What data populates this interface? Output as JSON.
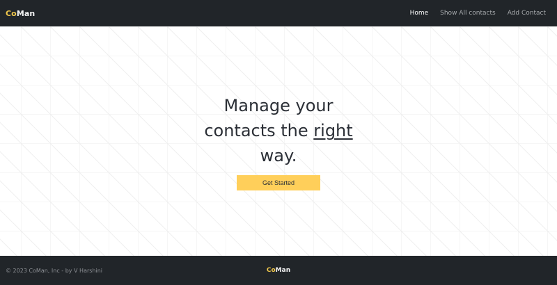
{
  "nav": {
    "brand_accent": "Co",
    "brand_rest": "Man",
    "links": [
      "Home",
      "Show All contacts",
      "Add Contact"
    ]
  },
  "hero": {
    "headline_before": "Manage your contacts the ",
    "headline_emphasis": "right",
    "headline_after": " way.",
    "cta_label": "Get Started"
  },
  "footer": {
    "copyright": "© 2023 CoMan, Inc - by V Harshini",
    "brand_accent": "Co",
    "brand_rest": "Man"
  },
  "colors": {
    "navbar_bg": "#212529",
    "brand_accent": "#f2c94c",
    "cta_bg": "#ffcf5a",
    "headline": "#2b2f36"
  }
}
